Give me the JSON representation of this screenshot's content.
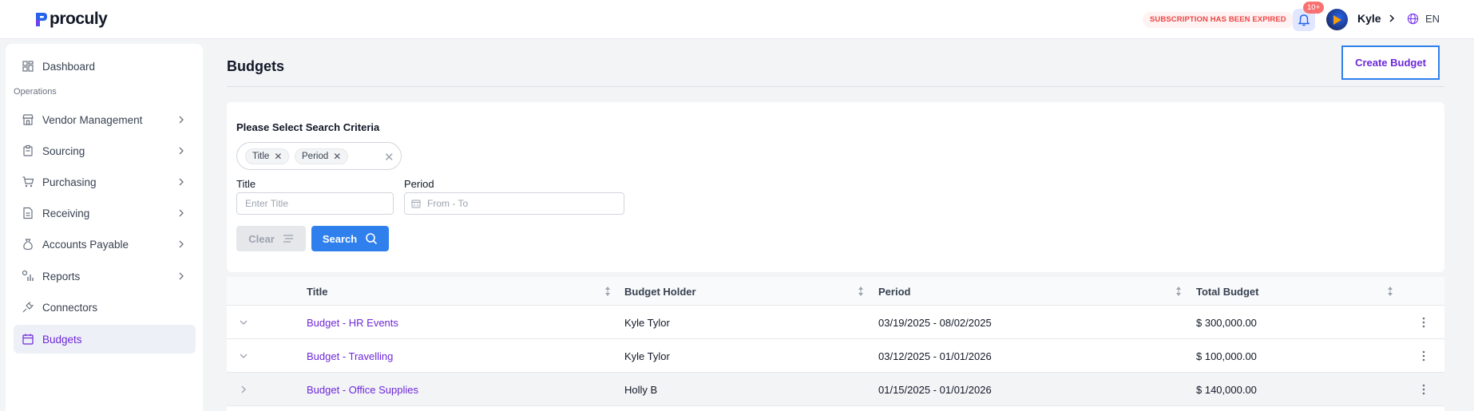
{
  "brand": {
    "name": "proculy"
  },
  "topbar": {
    "subscription_status": "SUBSCRIPTION HAS BEEN EXPIRED",
    "notification_count": "10+",
    "user_name": "Kyle",
    "language": "EN"
  },
  "sidebar": {
    "dashboard": "Dashboard",
    "section": "Operations",
    "items": [
      {
        "label": "Vendor Management",
        "icon": "store-icon"
      },
      {
        "label": "Sourcing",
        "icon": "clipboard-icon"
      },
      {
        "label": "Purchasing",
        "icon": "cart-icon"
      },
      {
        "label": "Receiving",
        "icon": "document-icon"
      },
      {
        "label": "Accounts Payable",
        "icon": "money-bag-icon"
      },
      {
        "label": "Reports",
        "icon": "report-chart-icon"
      },
      {
        "label": "Connectors",
        "icon": "plug-icon"
      },
      {
        "label": "Budgets",
        "icon": "calendar-budget-icon"
      }
    ]
  },
  "main": {
    "title": "Budgets",
    "create_button": "Create Budget"
  },
  "search": {
    "criteria_title": "Please Select Search Criteria",
    "chips": [
      "Title",
      "Period"
    ],
    "title_label": "Title",
    "title_placeholder": "Enter Title",
    "period_label": "Period",
    "period_placeholder": "From - To",
    "clear_label": "Clear",
    "search_label": "Search"
  },
  "table": {
    "columns": [
      "Title",
      "Budget Holder",
      "Period",
      "Total Budget"
    ],
    "rows": [
      {
        "title": "Budget - HR Events",
        "holder": "Kyle Tylor",
        "period": "03/19/2025 - 08/02/2025",
        "total": "$ 300,000.00",
        "expanded": true
      },
      {
        "title": "Budget - Travelling",
        "holder": "Kyle Tylor",
        "period": "03/12/2025 - 01/01/2026",
        "total": "$ 100,000.00",
        "expanded": true
      },
      {
        "title": "Budget - Office Supplies",
        "holder": "Holly B",
        "period": "01/15/2025 - 01/01/2026",
        "total": "$ 140,000.00",
        "expanded": false
      }
    ]
  },
  "colors": {
    "accent": "#6d28d9",
    "primary_button": "#2f80ed",
    "expired_text": "#ef4444",
    "badge": "#f87171"
  }
}
